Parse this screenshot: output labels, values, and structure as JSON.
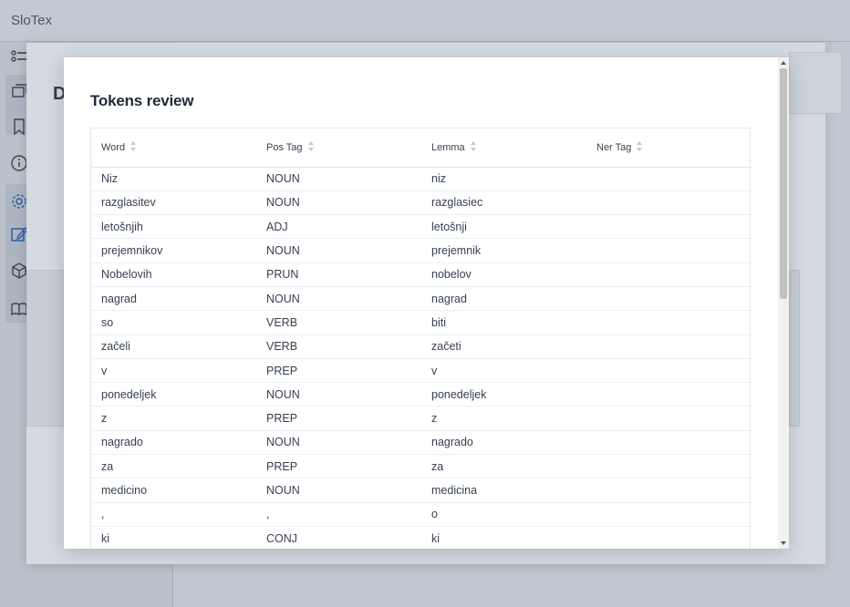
{
  "app": {
    "title": "SloTex"
  },
  "background": {
    "page_title_initial": "D"
  },
  "modal": {
    "title": "Tokens review",
    "columns": [
      "Word",
      "Pos Tag",
      "Lemma",
      "Ner Tag"
    ],
    "rows": [
      [
        "Niz",
        "NOUN",
        "niz",
        ""
      ],
      [
        "razglasitev",
        "NOUN",
        "razglasiec",
        ""
      ],
      [
        "letošnjih",
        "ADJ",
        "letošnji",
        ""
      ],
      [
        "prejemnikov",
        "NOUN",
        "prejemnik",
        ""
      ],
      [
        "Nobelovih",
        "PRUN",
        "nobelov",
        ""
      ],
      [
        "nagrad",
        "NOUN",
        "nagrad",
        ""
      ],
      [
        "so",
        "VERB",
        "biti",
        ""
      ],
      [
        "začeli",
        "VERB",
        "začeti",
        ""
      ],
      [
        "v",
        "PREP",
        "v",
        ""
      ],
      [
        "ponedeljek",
        "NOUN",
        "ponedeljek",
        ""
      ],
      [
        "z",
        "PREP",
        "z",
        ""
      ],
      [
        "nagrado",
        "NOUN",
        "nagrado",
        ""
      ],
      [
        "za",
        "PREP",
        "za",
        ""
      ],
      [
        "medicino",
        "NOUN",
        "medicina",
        ""
      ],
      [
        ",",
        ",",
        "o",
        ""
      ],
      [
        "ki",
        "CONJ",
        "ki",
        ""
      ]
    ]
  },
  "sidebar": {
    "icons": [
      "list-icon",
      "stack-icon",
      "bookmark-icon",
      "info-icon",
      "gear-icon",
      "edit-icon",
      "box-icon",
      "book-icon"
    ]
  }
}
